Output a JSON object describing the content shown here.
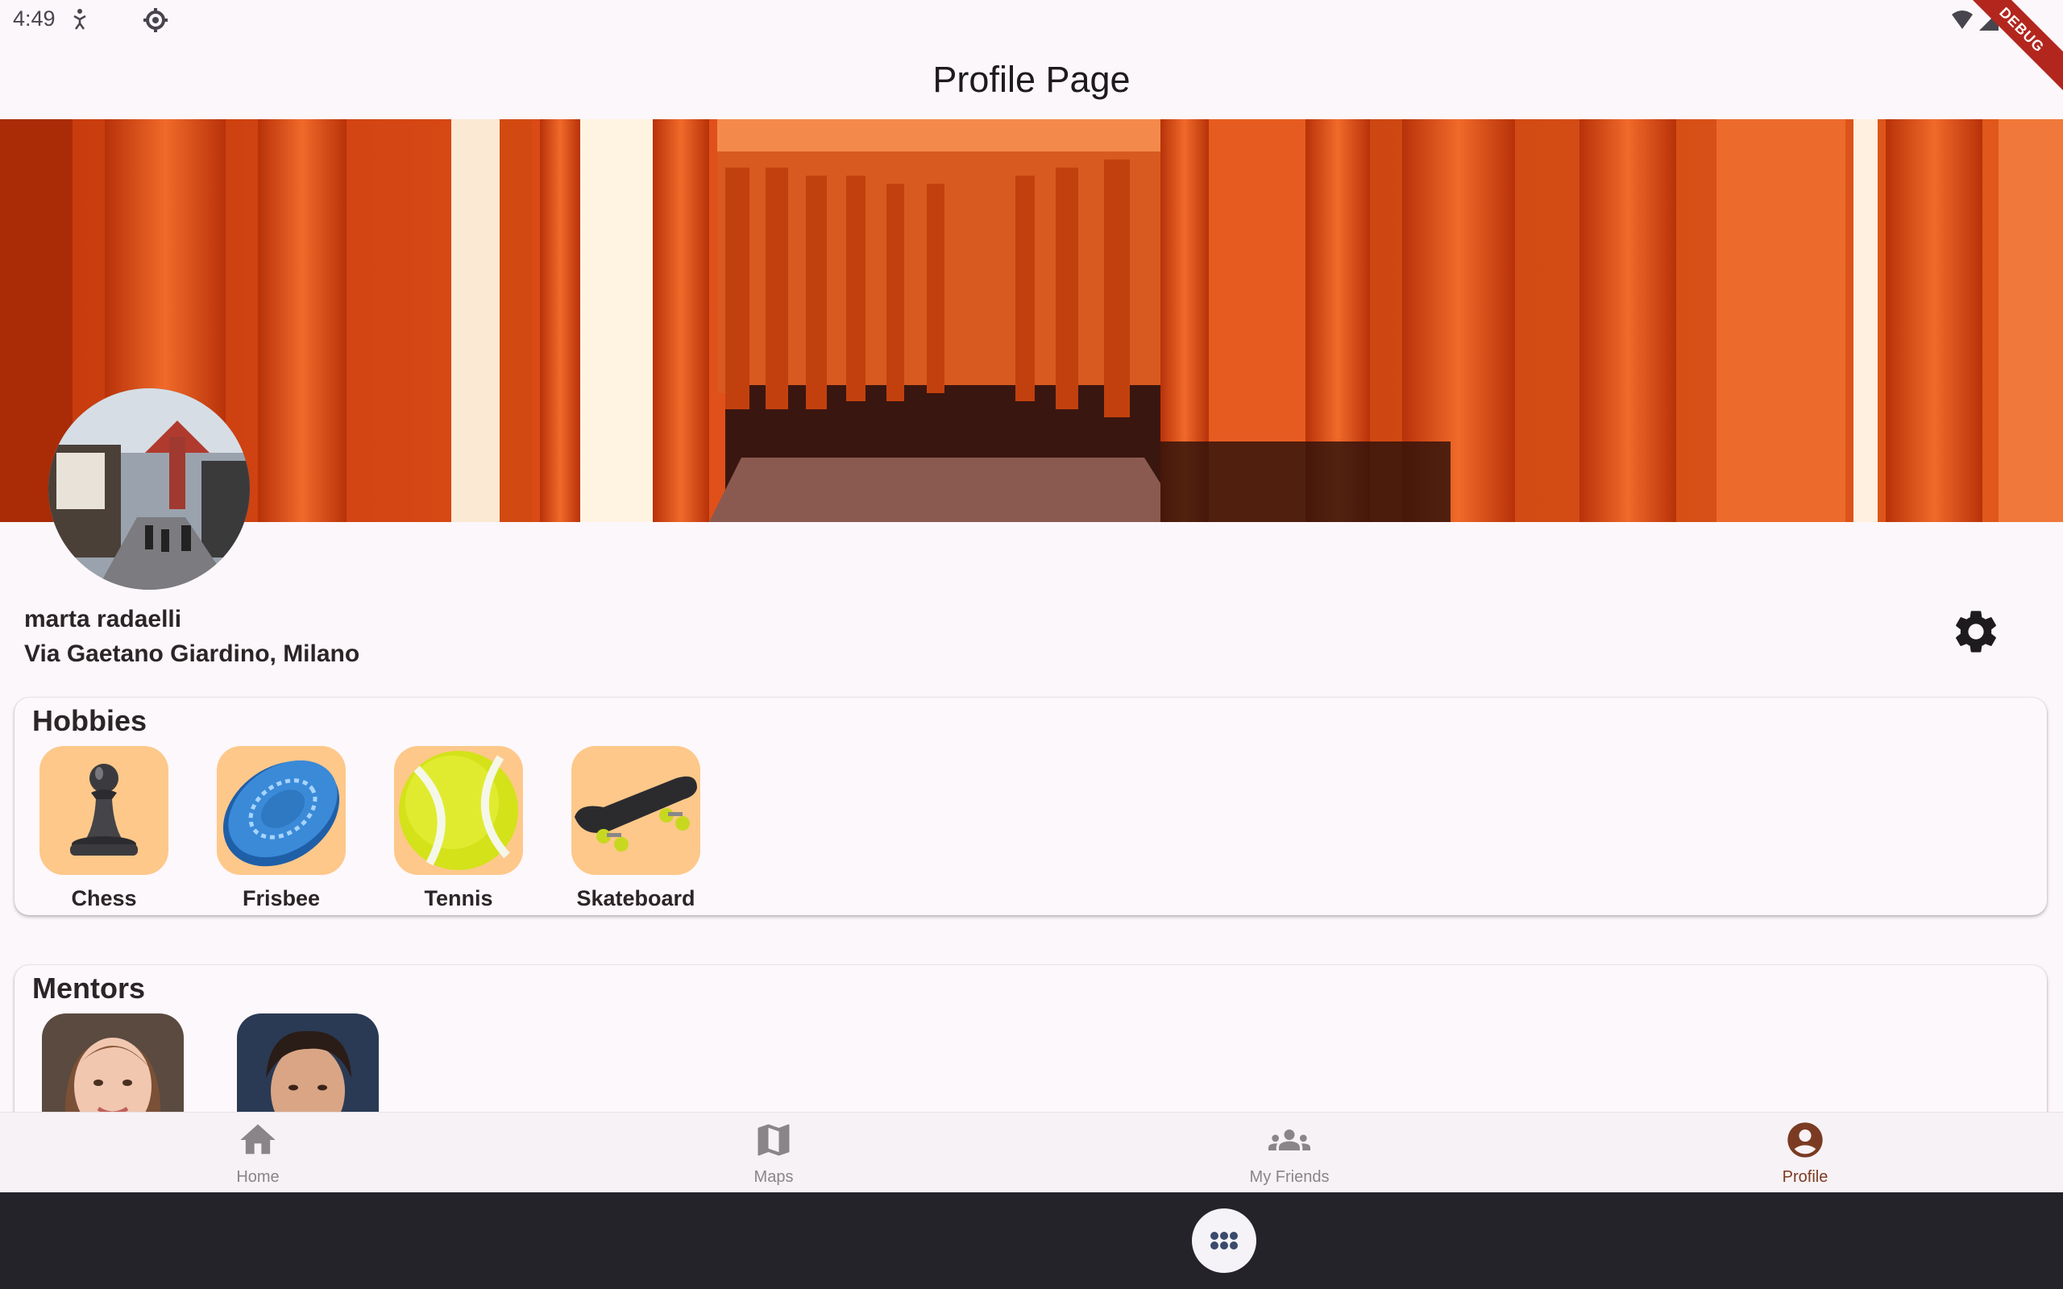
{
  "status_bar": {
    "time": "4:49",
    "debug_label": "DEBUG"
  },
  "app_bar": {
    "title": "Profile Page"
  },
  "profile": {
    "name": "marta radaelli",
    "address": "Via Gaetano Giardino, Milano"
  },
  "hobbies": {
    "title": "Hobbies",
    "items": [
      {
        "label": "Chess",
        "icon": "chess-pawn-icon"
      },
      {
        "label": "Frisbee",
        "icon": "frisbee-icon"
      },
      {
        "label": "Tennis",
        "icon": "tennis-ball-icon"
      },
      {
        "label": "Skateboard",
        "icon": "skateboard-icon"
      }
    ]
  },
  "mentors": {
    "title": "Mentors"
  },
  "bottom_nav": {
    "items": [
      {
        "label": "Home",
        "icon": "home-icon"
      },
      {
        "label": "Maps",
        "icon": "map-icon"
      },
      {
        "label": "My Friends",
        "icon": "group-icon"
      },
      {
        "label": "Profile",
        "icon": "account-circle-icon"
      }
    ],
    "active": "Profile"
  },
  "colors": {
    "background": "#fcf7fb",
    "hobby_tile": "#fdc88a",
    "active_nav": "#7a3b22",
    "system_nav": "#24232a"
  }
}
